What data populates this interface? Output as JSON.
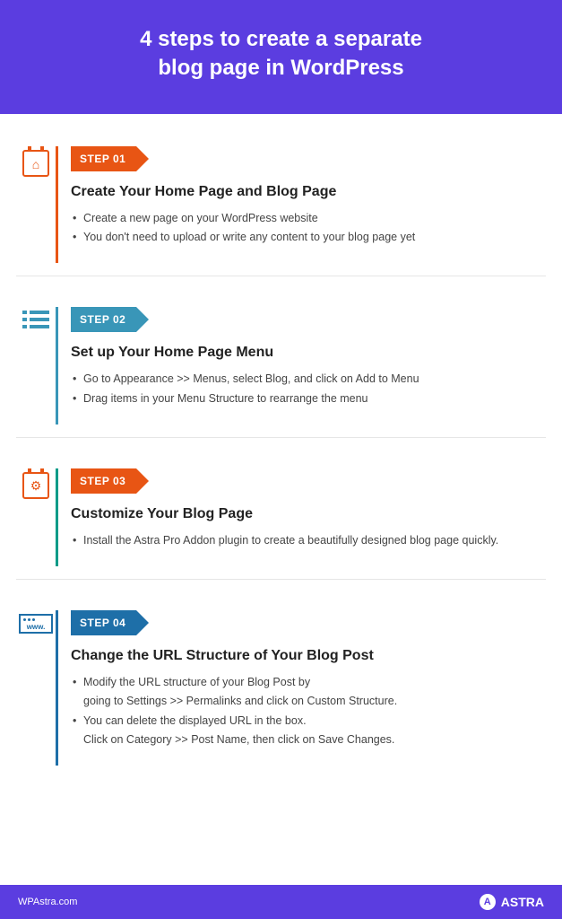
{
  "header": {
    "title_line1": "4 steps to create a separate",
    "title_line2": "blog page in WordPress"
  },
  "steps": [
    {
      "badge": "STEP 01",
      "title": "Create Your Home Page and Blog Page",
      "bullets": [
        "Create a new page on your WordPress website",
        "You don't need to upload or write any content to your blog page yet"
      ]
    },
    {
      "badge": "STEP 02",
      "title": "Set up Your Home Page Menu",
      "bullets": [
        "Go to Appearance >> Menus, select Blog, and click on Add to Menu",
        "Drag items in your Menu Structure to rearrange the menu"
      ]
    },
    {
      "badge": "STEP 03",
      "title": "Customize Your Blog Page",
      "bullets": [
        "Install the Astra Pro Addon plugin to create a beautifully designed blog page quickly."
      ]
    },
    {
      "badge": "STEP 04",
      "title": "Change the URL Structure of Your Blog Post",
      "bullets": [
        "Modify the URL structure of your Blog Post by\ngoing to Settings >> Permalinks and click on Custom Structure.",
        "You can delete the displayed URL in the box.\nClick on Category >> Post Name, then click on Save Changes."
      ]
    }
  ],
  "footer": {
    "site": "WPAstra.com",
    "brand": "ASTRA",
    "brand_letter": "A"
  },
  "icon_www_label": "www."
}
